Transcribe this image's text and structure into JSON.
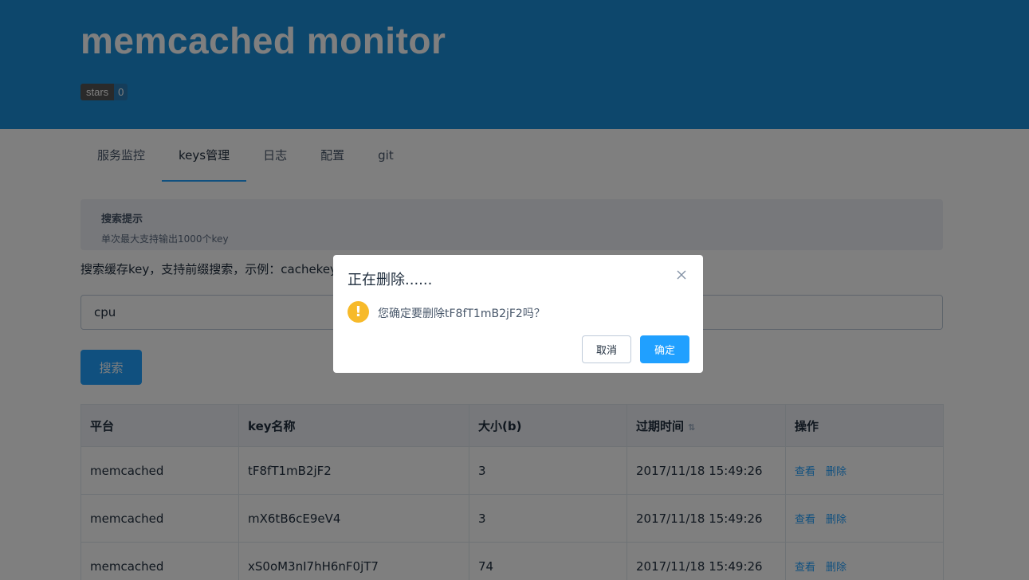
{
  "header": {
    "title": "memcached monitor",
    "badge_label": "stars",
    "badge_count": "0"
  },
  "tabs": [
    {
      "label": "服务监控",
      "active": false
    },
    {
      "label": "keys管理",
      "active": true
    },
    {
      "label": "日志",
      "active": false
    },
    {
      "label": "配置",
      "active": false
    },
    {
      "label": "git",
      "active": false
    }
  ],
  "alert": {
    "title": "搜索提示",
    "description": "单次最大支持输出1000个key"
  },
  "search": {
    "hint": "搜索缓存key，支持前缀搜索，示例：cachekey",
    "value": "cpu",
    "button_label": "搜索"
  },
  "table": {
    "columns": [
      "平台",
      "key名称",
      "大小(b)",
      "过期时间",
      "操作"
    ],
    "sort_icon": "⇅",
    "rows": [
      {
        "platform": "memcached",
        "key": "tF8fT1mB2jF2",
        "size": "3",
        "expire": "2017/11/18 15:49:26",
        "view": "查看",
        "delete": "删除"
      },
      {
        "platform": "memcached",
        "key": "mX6tB6cE9eV4",
        "size": "3",
        "expire": "2017/11/18 15:49:26",
        "view": "查看",
        "delete": "删除"
      },
      {
        "platform": "memcached",
        "key": "xS0oM3nI7hH6nF0jT7",
        "size": "74",
        "expire": "2017/11/18 15:49:26",
        "view": "查看",
        "delete": "删除"
      }
    ]
  },
  "dialog": {
    "title": "正在删除......",
    "icon": "warning-icon",
    "icon_glyph": "!",
    "message": "您确定要删除tF8fT1mB2jF2吗？",
    "cancel_label": "取消",
    "confirm_label": "确定"
  },
  "colors": {
    "header_bg": "#1a8fd9",
    "accent": "#20a0ff",
    "warning": "#f7ba2a",
    "mask": "rgba(0,0,0,0.5)"
  }
}
